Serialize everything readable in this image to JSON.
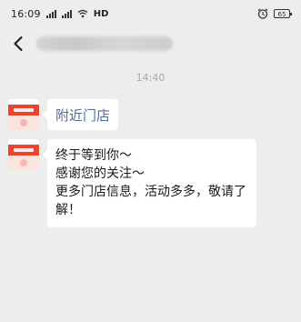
{
  "status_bar": {
    "time": "16:09",
    "network_label": "HD",
    "signal_label_1": "4G",
    "signal_label_2": "4G",
    "battery_level": "65"
  },
  "header": {
    "back_icon": "chevron-left-icon",
    "title": ""
  },
  "chat": {
    "timestamp": "14:40",
    "messages": [
      {
        "type": "link",
        "text": "附近门店"
      },
      {
        "type": "text",
        "lines": [
          "终于等到你～",
          "感谢您的关注～",
          "更多门店信息，活动多多，敬请了解！"
        ]
      }
    ]
  },
  "colors": {
    "background": "#ededed",
    "bubble": "#ffffff",
    "link": "#576b95",
    "avatar_accent": "#e8452f"
  }
}
